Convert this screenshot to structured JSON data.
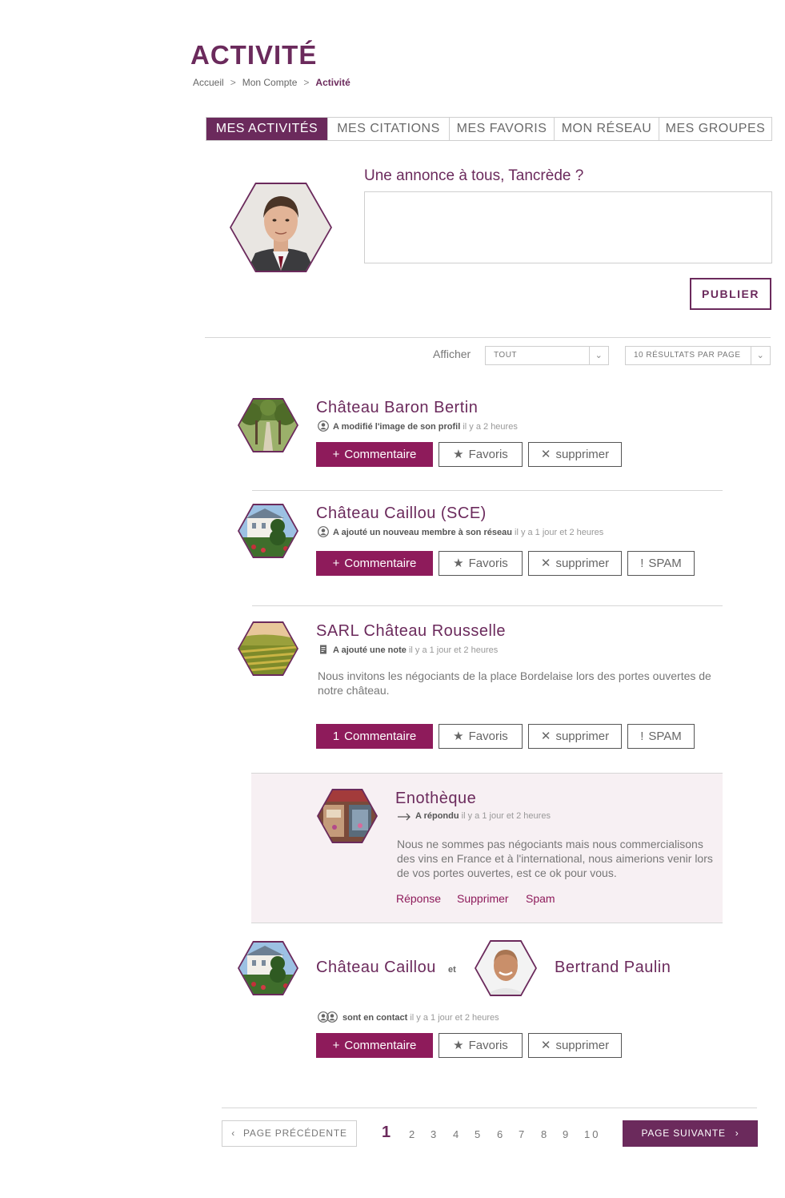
{
  "page": {
    "title": "ACTIVITÉ",
    "breadcrumb": {
      "items": [
        "Accueil",
        "Mon Compte"
      ],
      "current": "Activité",
      "separator": ">"
    }
  },
  "tabs": [
    {
      "label": "MES ACTIVITÉS",
      "active": true
    },
    {
      "label": "MES CITATIONS",
      "active": false
    },
    {
      "label": "MES FAVORIS",
      "active": false
    },
    {
      "label": "MON RÉSEAU",
      "active": false
    },
    {
      "label": "MES GROUPES",
      "active": false
    }
  ],
  "announce": {
    "label": "Une annonce à tous, Tancrède ?",
    "value": "",
    "publish_label": "PUBLIER"
  },
  "filter": {
    "label": "Afficher",
    "type_value": "TOUT",
    "per_page_value": "10 RÉSULTATS PAR PAGE"
  },
  "buttons": {
    "comment": "Commentaire",
    "favorite": "Favoris",
    "delete": "supprimer",
    "spam": "SPAM"
  },
  "entries": [
    {
      "name": "Château Baron Bertin",
      "action": "A modifié l'image de son profil",
      "time": "il y a  2 heures",
      "comment_prefix": "+"
    },
    {
      "name": "Château Caillou (SCE)",
      "action": "A ajouté un nouveau membre à son réseau",
      "time": "il y a 1 jour et 2 heures",
      "comment_prefix": "+"
    },
    {
      "name": "SARL Château Rousselle",
      "action": "A ajouté une note",
      "time": "il y a 1 jour et 2 heures",
      "text": "Nous invitons les négociants de la place Bordelaise lors des portes ouvertes de notre château.",
      "comment_prefix": "1"
    }
  ],
  "reply": {
    "name": "Enothèque",
    "action": "A répondu",
    "time": "il y a 1 jour et 2 heures",
    "text": "Nous ne sommes pas négociants mais nous commercialisons des vins en France et à l'international, nous aimerions venir lors de vos portes ouvertes, est ce ok pour vous.",
    "links": [
      "Réponse",
      "Supprimer",
      "Spam"
    ]
  },
  "contact_entry": {
    "name_a": "Château Caillou",
    "conjunction": "et",
    "name_b": "Bertrand Paulin",
    "action": "sont en contact",
    "time": "il y a 1 jour et 2 heures",
    "comment_prefix": "+"
  },
  "pagination": {
    "prev_label": "PAGE PRÉCÉDENTE",
    "next_label": "PAGE SUIVANTE",
    "pages": [
      "1",
      "2",
      "3",
      "4",
      "5",
      "6",
      "7",
      "8",
      "9",
      "10"
    ],
    "current": "1"
  },
  "colors": {
    "brand": "#6b2a5c",
    "button_primary": "#8e1b5b",
    "reply_bg": "#f7f0f3"
  },
  "icons": {
    "profile": "user-circle-icon",
    "note": "note-icon",
    "reply": "reply-arrow-icon",
    "contacts": "users-pair-icon",
    "favorite": "star-icon",
    "delete": "close-icon",
    "spam": "exclamation-icon",
    "dropdown": "chevron-down-icon",
    "prev": "chevron-left-icon",
    "next": "chevron-right-icon"
  }
}
